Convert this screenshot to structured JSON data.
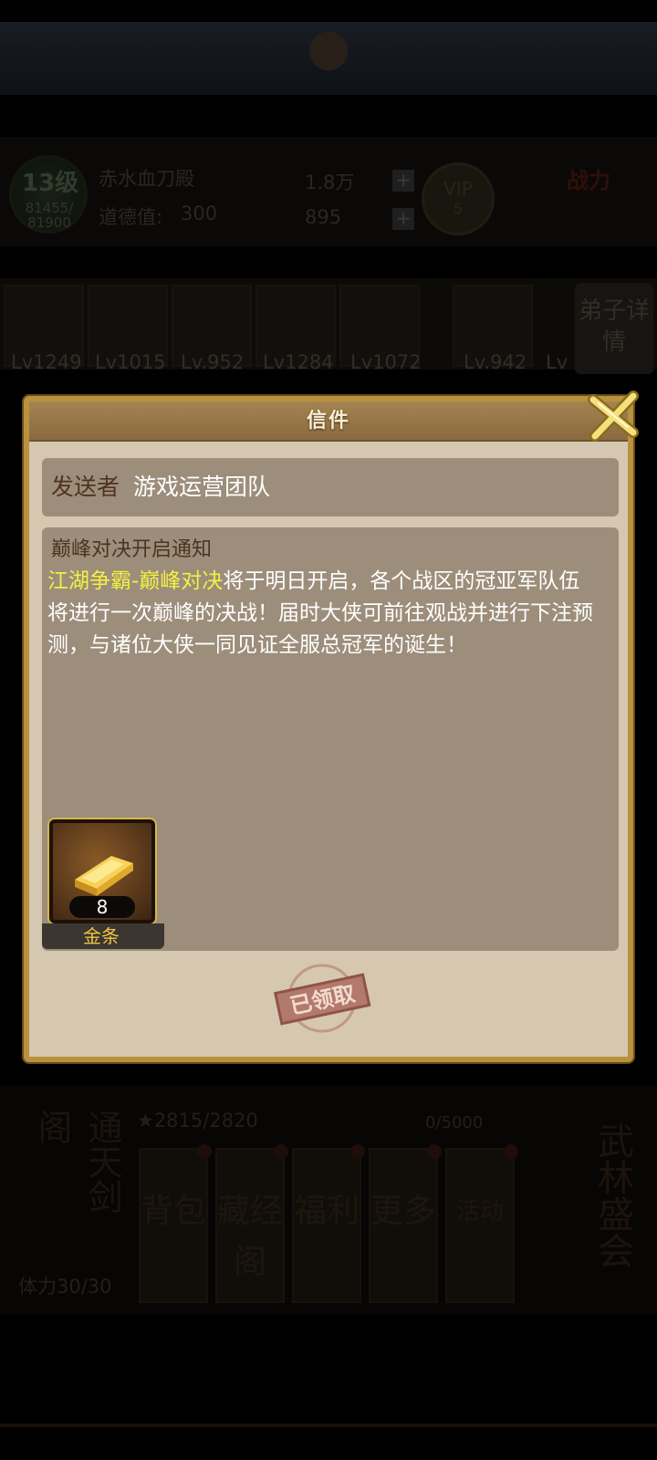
{
  "background": {
    "player_level": "13级",
    "exp_current": "81455/",
    "exp_max": "81900",
    "player_name": "赤水血刀殿",
    "reputation_label": "道德值:",
    "reputation_value": "300",
    "silver": "1.8万",
    "gold": "895",
    "vip_label": "VIP",
    "vip_level": "5",
    "power_label": "战力",
    "heroes": [
      "Lv1249",
      "Lv1015",
      "Lv.952",
      "Lv1284",
      "Lv1072",
      "Lv.942",
      "Lv"
    ],
    "disciple_button": "弟子详情",
    "stars": "★2815/2820",
    "progress": "0/5000",
    "left_scroll": "通天剑阁",
    "stamina": "体力30/30",
    "menu": [
      "背包",
      "藏经阁",
      "福利",
      "更多",
      "活动"
    ],
    "right_scroll": "武林盛会"
  },
  "dialog": {
    "title": "信件",
    "sender_label": "发送者",
    "sender_value": "游戏运营团队",
    "subject": "巅峰对决开启通知",
    "body_highlight": "江湖争霸-巅峰对决",
    "body_text": "将于明日开启，各个战区的冠亚军队伍将进行一次巅峰的决战！届时大侠可前往观战并进行下注预测，与诸位大侠一同见证全服总冠军的诞生！",
    "reward": {
      "icon": "gold-bar-icon",
      "count": "8",
      "name": "金条"
    },
    "stamp_text": "已领取"
  },
  "colors": {
    "dialog_bg": "#d6c8b0",
    "dialog_border": "#b8923d",
    "panel_bg": "#9c8e7b",
    "highlight": "#f4f040",
    "reward_name": "#f0c540",
    "label_brown": "#4e3222"
  }
}
